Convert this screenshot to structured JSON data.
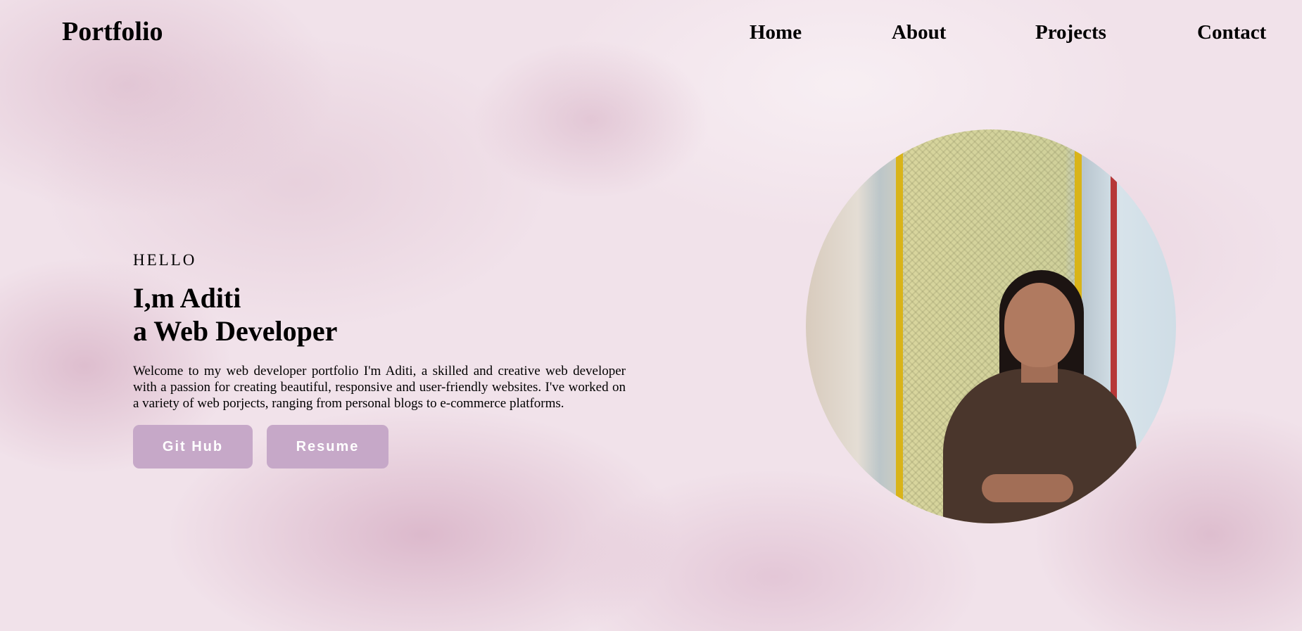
{
  "header": {
    "logo": "Portfolio",
    "nav": {
      "home": "Home",
      "about": "About",
      "projects": "Projects",
      "contact": "Contact"
    }
  },
  "hero": {
    "greeting": "HELLO",
    "title_line1": "I,m Aditi",
    "title_line2": "a Web Developer",
    "intro": "Welcome to my web developer portfolio I'm Aditi, a skilled and creative web developer with a passion for creating beautiful, responsive and user-friendly websites. I've worked on a variety of web porjects, ranging from personal blogs to e-commerce platforms.",
    "buttons": {
      "github": "Git Hub",
      "resume": "Resume"
    }
  },
  "colors": {
    "button_bg": "#c6a8c8",
    "page_bg": "#f1e2ea"
  }
}
